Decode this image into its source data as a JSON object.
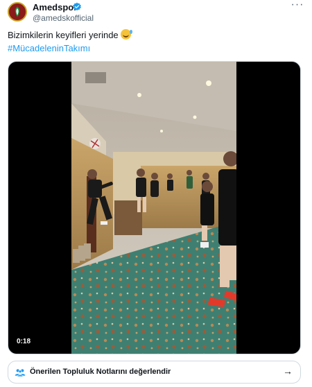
{
  "post": {
    "author_name": "Amedspor",
    "author_handle": "@amedskofficial",
    "verified": true,
    "text": "Bizimkilerin keyifleri yerinde",
    "emoji": "grinning-face-with-sweat",
    "hashtag": "#MücadeleninTakımı"
  },
  "media": {
    "type": "video",
    "timestamp": "0:18"
  },
  "community_notes": {
    "label": "Önerilen Topluluk Notlarını değerlendir",
    "arrow": "→"
  },
  "colors": {
    "accent": "#1d9bf0",
    "text": "#0f1419",
    "muted": "#536471",
    "border": "#cfd9de",
    "brand_red": "#8b1a1a",
    "brand_gold": "#c9a227"
  }
}
